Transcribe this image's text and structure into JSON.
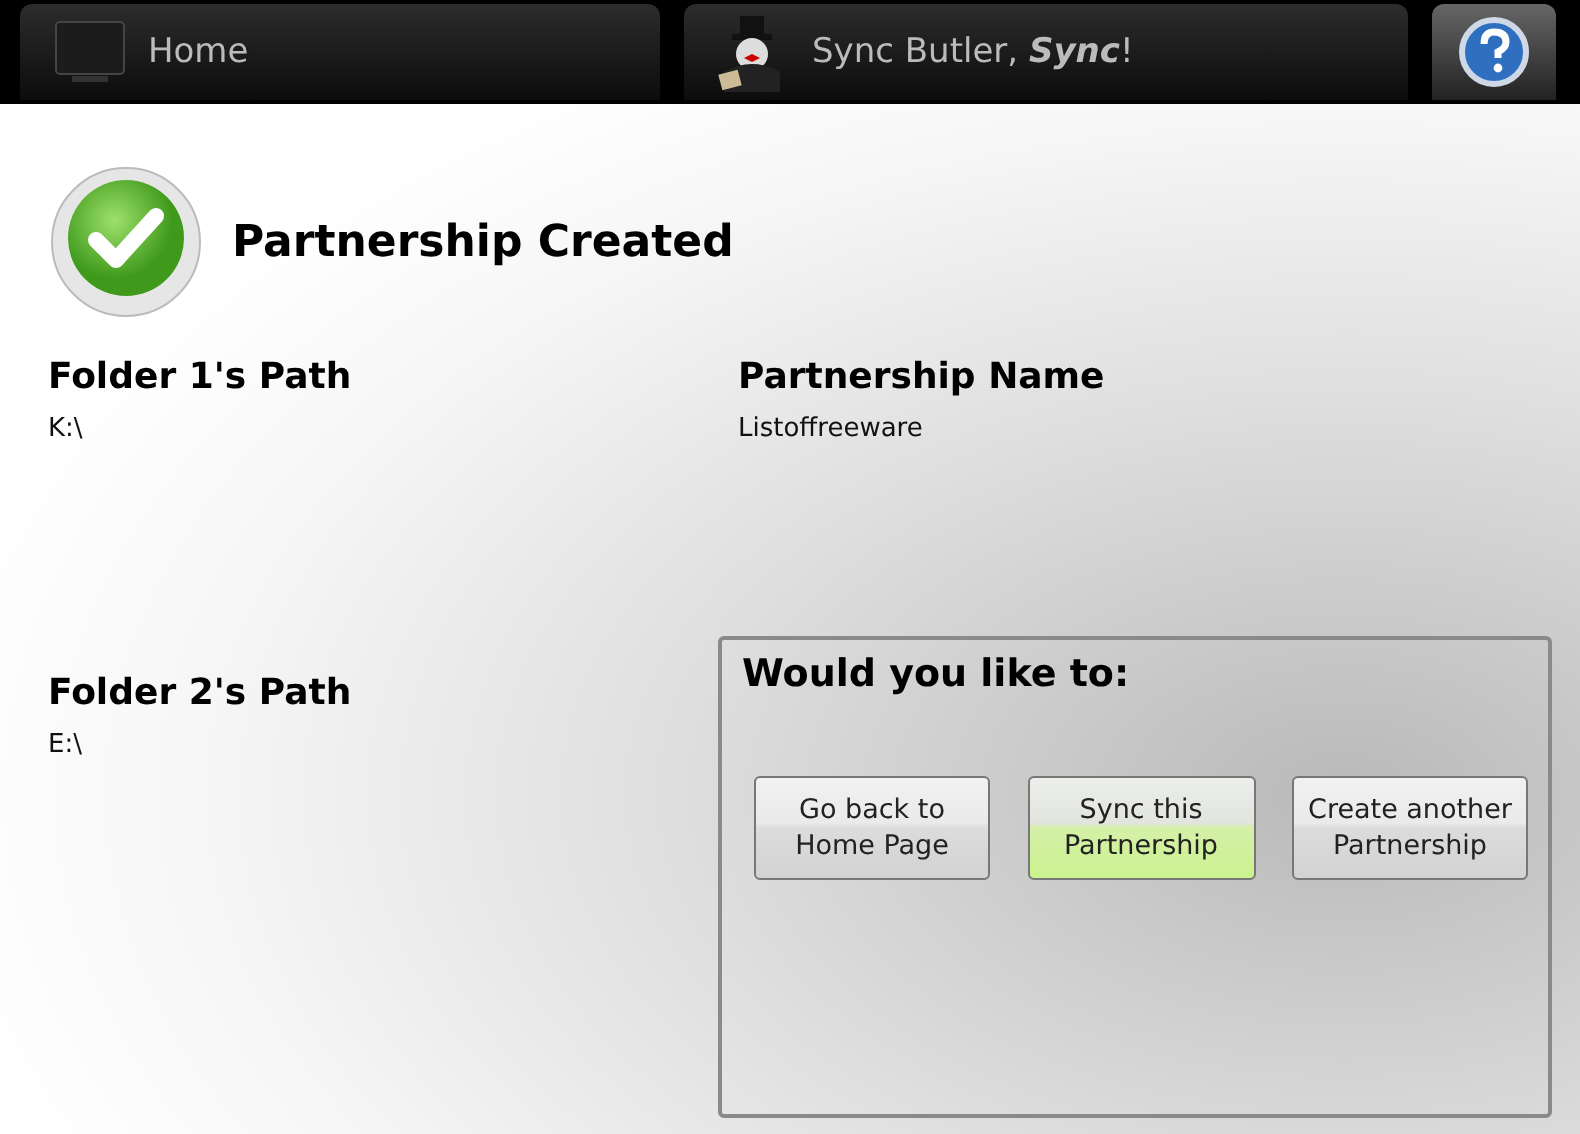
{
  "top_bar": {
    "home_tab": {
      "label": "Home"
    },
    "app_tab": {
      "label": "Sync Butler, **Sync**!"
    }
  },
  "heading": "Partnership Created",
  "folder_1": {
    "label": "Folder 1's Path",
    "value": "K:\\"
  },
  "partnership_name": {
    "label": "Partnership Name",
    "value": "Listoffreeware"
  },
  "folder_2": {
    "label": "Folder 2's Path",
    "value": "E:\\"
  },
  "actions": {
    "title": "Would you like to:",
    "buttons": [
      {
        "label": "Go back to Home Page",
        "highlighted": false
      },
      {
        "label": "Sync this Partnership",
        "highlighted": true
      },
      {
        "label": "Create another Partnership",
        "highlighted": false
      }
    ]
  }
}
